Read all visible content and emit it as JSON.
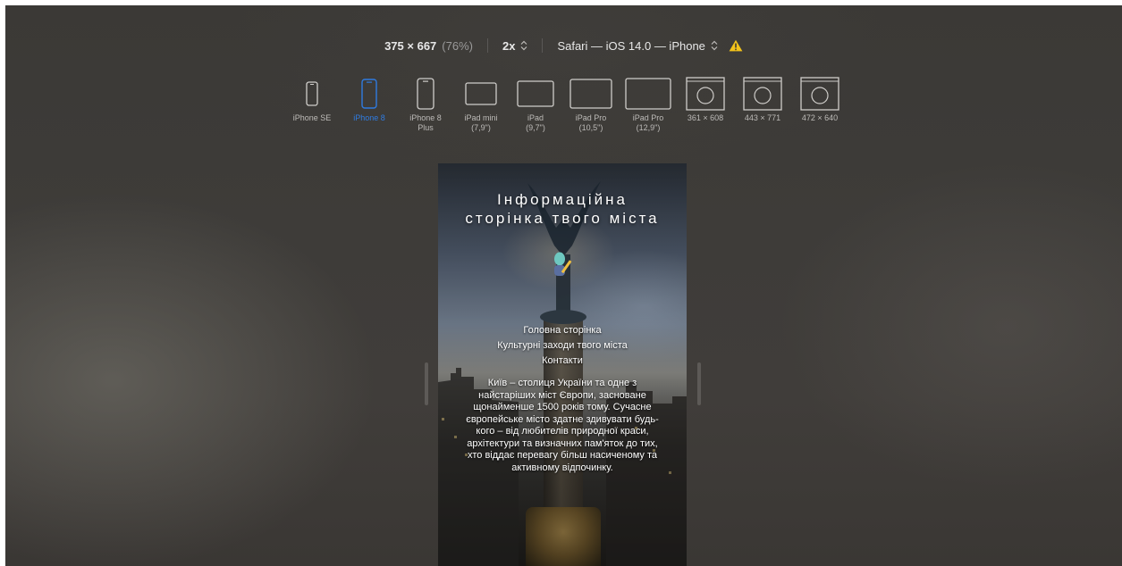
{
  "toolbar": {
    "size": "375 × 667",
    "zoom": "(76%)",
    "scale": "2x",
    "browser": "Safari — iOS 14.0 — iPhone"
  },
  "devices": [
    {
      "label": "iPhone SE",
      "icon": "iphone-se-icon",
      "active": false
    },
    {
      "label": "iPhone 8",
      "icon": "iphone-8-icon",
      "active": true
    },
    {
      "label": "iPhone 8\nPlus",
      "icon": "iphone-8-plus-icon",
      "active": false
    },
    {
      "label": "iPad mini\n(7,9\")",
      "icon": "ipad-mini-icon",
      "active": false
    },
    {
      "label": "iPad\n(9,7\")",
      "icon": "ipad-icon",
      "active": false
    },
    {
      "label": "iPad Pro\n(10,5\")",
      "icon": "ipad-pro-10-icon",
      "active": false
    },
    {
      "label": "iPad Pro\n(12,9\")",
      "icon": "ipad-pro-12-icon",
      "active": false
    },
    {
      "label": "361 × 608",
      "icon": "compass-icon",
      "active": false
    },
    {
      "label": "443 × 771",
      "icon": "compass-icon",
      "active": false
    },
    {
      "label": "472 × 640",
      "icon": "compass-icon",
      "active": false
    }
  ],
  "site": {
    "title": "Інформаційна сторінка твого міста",
    "nav": [
      "Головна сторінка",
      "Культурні заходи твого міста",
      "Контакти"
    ],
    "description": "Київ – столиця України та одне з найстаріших міст Європи, засноване щонайменше 1500 років тому. Сучасне європейське місто здатне здивувати будь-кого – від любителів природної краси, архітектури та визначних пам'яток до тих, хто віддає перевагу більш насиченому та активному відпочинку."
  },
  "colors": {
    "accent": "#2f7be0",
    "warning": "#f2c21a"
  }
}
